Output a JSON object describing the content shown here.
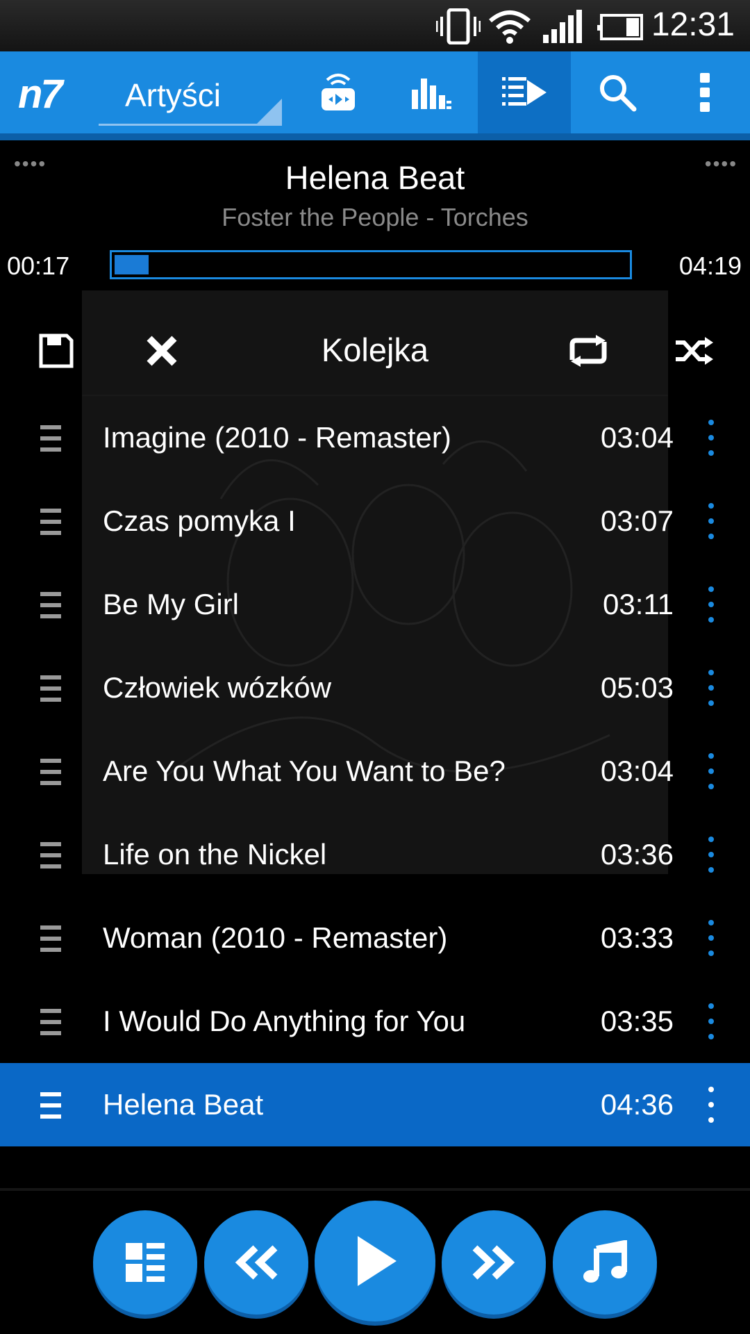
{
  "status_bar": {
    "time": "12:31",
    "icons": [
      "vibrate-icon",
      "wifi-icon",
      "signal-icon",
      "battery-icon"
    ]
  },
  "toolbar": {
    "logo": "n7",
    "view_selector": "Artyści",
    "buttons": [
      "cast-icon",
      "equalizer-icon",
      "queue-icon",
      "search-icon",
      "overflow-menu-icon"
    ],
    "active_button": "queue-icon"
  },
  "now_playing": {
    "title": "Helena Beat",
    "subtitle": "Foster the People - Torches",
    "elapsed": "00:17",
    "total": "04:19",
    "progress": 0.066
  },
  "queue": {
    "title": "Kolejka",
    "items": [
      {
        "title": "Imagine (2010 - Remaster)",
        "duration": "03:04"
      },
      {
        "title": "Czas pomyka I",
        "duration": "03:07"
      },
      {
        "title": "Be My Girl",
        "duration": "03:11"
      },
      {
        "title": "Człowiek wózków",
        "duration": "05:03"
      },
      {
        "title": "Are You What You Want to Be?",
        "duration": "03:04"
      },
      {
        "title": "Life on the Nickel",
        "duration": "03:36"
      },
      {
        "title": "Woman (2010 - Remaster)",
        "duration": "03:33"
      },
      {
        "title": "I Would Do Anything for You",
        "duration": "03:35"
      },
      {
        "title": "Helena Beat",
        "duration": "04:36"
      }
    ],
    "current_index": 8
  },
  "controls": [
    "library-icon",
    "rewind-icon",
    "play-icon",
    "fast-forward-icon",
    "music-note-icon"
  ],
  "colors": {
    "accent": "#1a8ae0",
    "selected_row": "#0a68c6"
  }
}
